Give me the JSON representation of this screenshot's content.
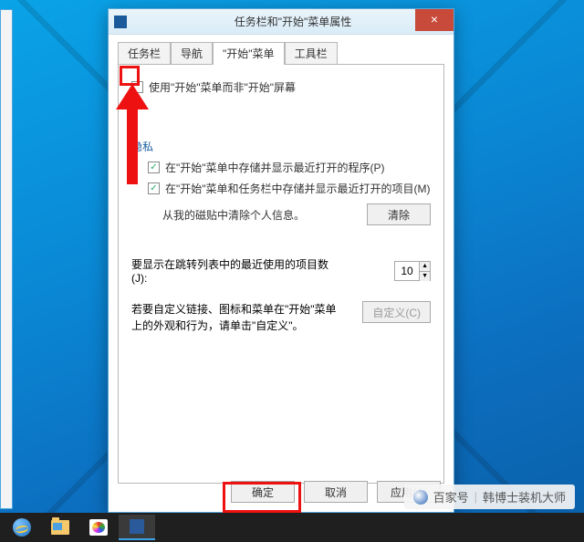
{
  "window": {
    "title": "任务栏和\"开始\"菜单属性"
  },
  "tabs": {
    "t1": "任务栏",
    "t2": "导航",
    "t3": "\"开始\"菜单",
    "t4": "工具栏"
  },
  "opt_use_start_menu": "使用\"开始\"菜单而非\"开始\"屏幕",
  "section_privacy": "隐私",
  "opt_store_programs": "在\"开始\"菜单中存储并显示最近打开的程序(P)",
  "opt_store_items": "在\"开始\"菜单和任务栏中存储并显示最近打开的项目(M)",
  "clear_tiles_label": "从我的磁贴中清除个人信息。",
  "clear_button": "清除",
  "jumplist_label": "要显示在跳转列表中的最近使用的项目数(J):",
  "jumplist_value": "10",
  "customize_text": "若要自定义链接、图标和菜单在\"开始\"菜单上的外观和行为，请单击\"自定义\"。",
  "customize_button": "自定义(C)",
  "buttons": {
    "ok": "确定",
    "cancel": "取消",
    "apply": "应用(A)"
  },
  "watermark": {
    "brand": "百家号",
    "author": "韩博士装机大师"
  }
}
